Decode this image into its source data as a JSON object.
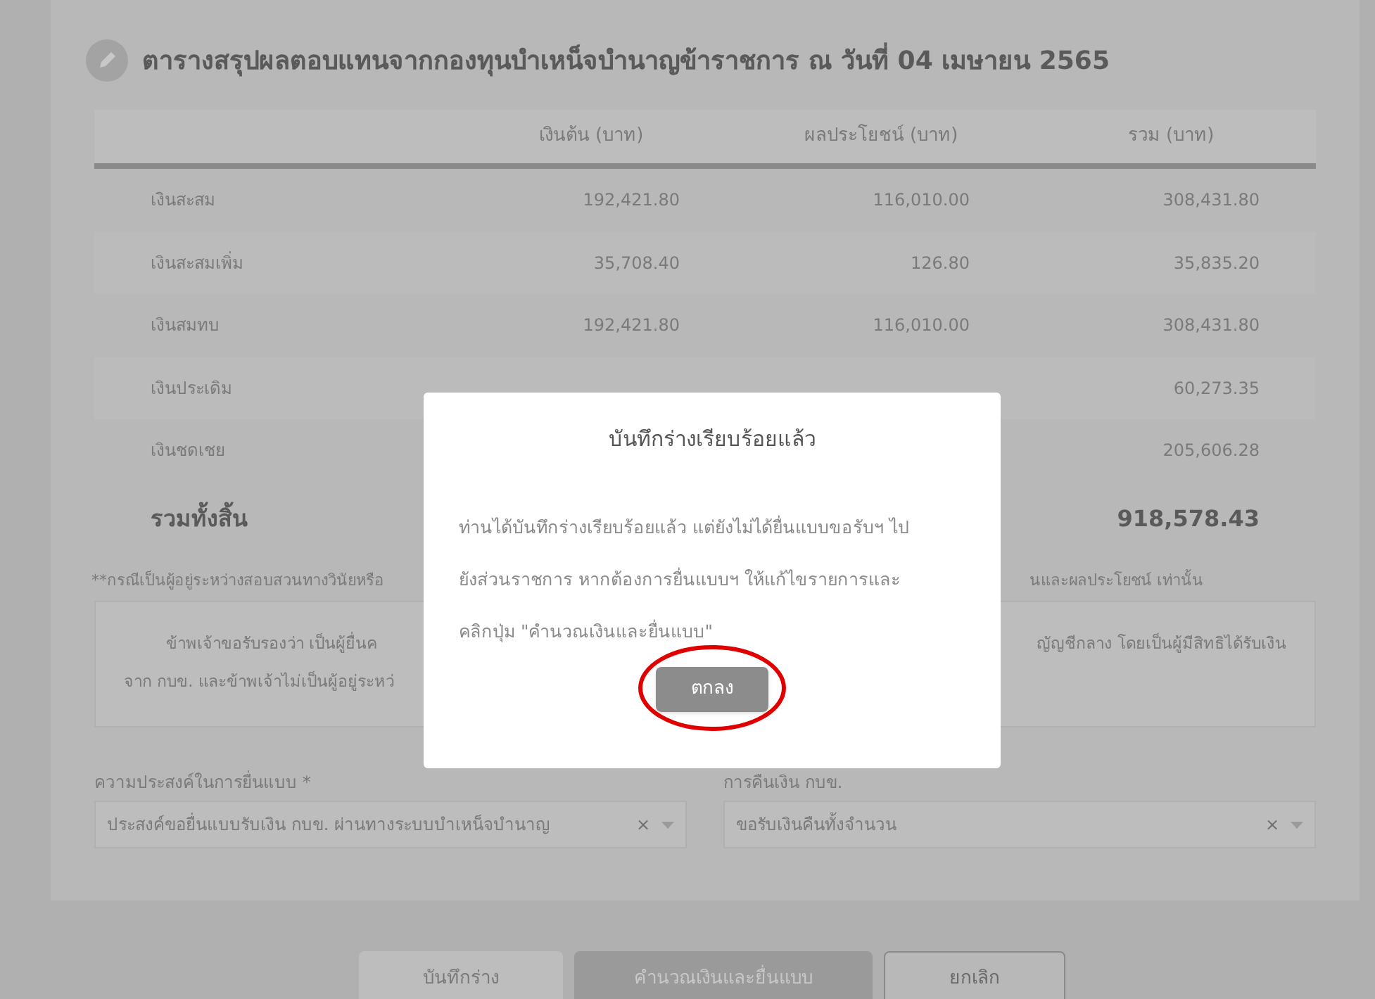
{
  "summary": {
    "title": "ตารางสรุปผลตอบแทนจากกองทุนบำเหน็จบำนาญข้าราชการ ณ วันที่ 04 เมษายน 2565",
    "columns": [
      "เงินต้น (บาท)",
      "ผลประโยชน์ (บาท)",
      "รวม (บาท)"
    ],
    "rows": [
      {
        "label": "เงินสะสม",
        "cells": [
          "192,421.80",
          "116,010.00",
          "308,431.80"
        ]
      },
      {
        "label": "เงินสะสมเพิ่ม",
        "cells": [
          "35,708.40",
          "126.80",
          "35,835.20"
        ]
      },
      {
        "label": "เงินสมทบ",
        "cells": [
          "192,421.80",
          "116,010.00",
          "308,431.80"
        ]
      },
      {
        "label": "เงินประเดิม",
        "cells": [
          "",
          "",
          "60,273.35"
        ]
      },
      {
        "label": "เงินชดเชย",
        "cells": [
          "",
          "",
          "205,606.28"
        ]
      }
    ],
    "total": {
      "label": "รวมทั้งสิ้น",
      "value": "918,578.43"
    }
  },
  "note": {
    "left": "**กรณีเป็นผู้อยู่ระหว่างสอบสวนทางวินัยหรือ",
    "right": "นและผลประโยชน์ เท่านั้น"
  },
  "certification": {
    "line_1_left": "ข้าพเจ้าขอรับรองว่า เป็นผู้ยื่นค",
    "line_1_right": "ญัญชีกลาง โดยเป็นผู้มีสิทธิได้รับเงิน",
    "line_2_left": "จาก กบข. และข้าพเจ้าไม่เป็นผู้อยู่ระหว่"
  },
  "fields": [
    {
      "label": "ความประสงค์ในการยื่นแบบ *",
      "value": "ประสงค์ขอยื่นแบบรับเงิน กบข. ผ่านทางระบบบำเหน็จบำนาญ",
      "clear": "×"
    },
    {
      "label": "การคืนเงิน กบข.",
      "value": "ขอรับเงินคืนทั้งจำนวน",
      "clear": "×"
    }
  ],
  "buttons": [
    {
      "label": "บันทึกร่าง",
      "kind": "secondary"
    },
    {
      "label": "คำนวณเงินและยื่นแบบ",
      "kind": "primary"
    },
    {
      "label": "ยกเลิก",
      "kind": "outline"
    }
  ],
  "dialog": {
    "title": "บันทึกร่างเรียบร้อยแล้ว",
    "lines": [
      "ท่านได้บันทึกร่างเรียบร้อยแล้ว แต่ยังไม่ได้ยื่นแบบขอรับฯ ไป",
      "ยังส่วนราชการ หากต้องการยื่นแบบฯ ให้แก้ไขรายการและ",
      "คลิกปุ่ม \"คำนวณเงินและยื่นแบบ\""
    ],
    "ok": "ตกลง",
    "highlighted": true
  }
}
